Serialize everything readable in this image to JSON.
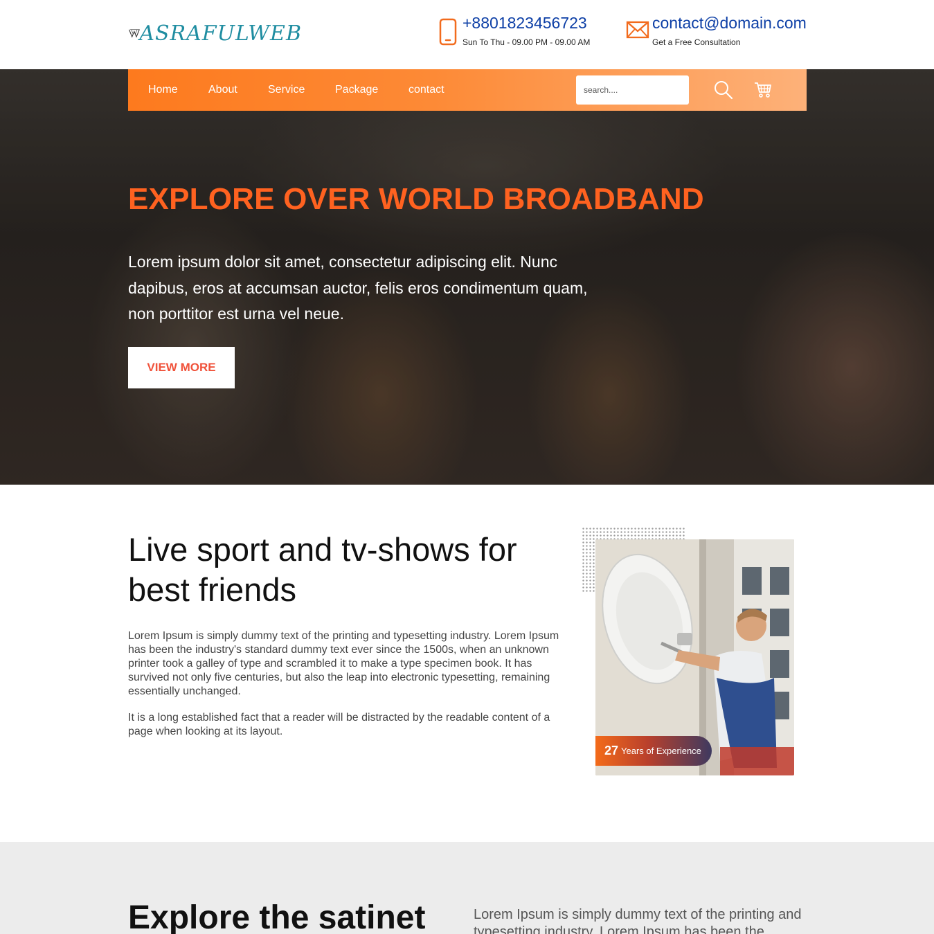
{
  "brand": {
    "name": "ASRAFULWEB",
    "logo_icon": "w-monogram-icon"
  },
  "contact": {
    "phone": "+8801823456723",
    "phone_hours": "Sun To Thu - 09.00 PM - 09.00 AM",
    "email": "contact@domain.com",
    "email_sub": "Get a Free Consultation"
  },
  "nav": {
    "items": [
      "Home",
      "About",
      "Service",
      "Package",
      "contact"
    ],
    "search_placeholder": "search....",
    "icons": [
      "search-icon",
      "cart-icon"
    ]
  },
  "hero": {
    "title": "EXPLORE OVER WORLD BROADBAND",
    "text": "Lorem ipsum dolor sit amet, consectetur adipiscing elit. Nunc dapibus, eros at accumsan auctor, felis eros condimentum quam, non porttitor est urna vel neue.",
    "button": "VIEW MORE"
  },
  "about": {
    "title": "Live sport and tv-shows for best friends",
    "paragraph1": "Lorem Ipsum is simply dummy text of the printing and typesetting industry. Lorem Ipsum has been the industry's standard dummy text ever since the 1500s, when an unknown printer took a galley of type and scrambled it to make a type specimen book. It has survived not only five centuries, but also the leap into electronic typesetting, remaining essentially unchanged.",
    "paragraph2": "It is a long established fact that a reader will be distracted by the readable content of a page when looking at its layout.",
    "experience_years": "27",
    "experience_label": "Years of Experience"
  },
  "explore": {
    "title": "Explore the satinet",
    "text": "Lorem Ipsum is simply dummy text of the printing and typesetting industry. Lorem Ipsum has been the"
  },
  "colors": {
    "accent": "#ff6220",
    "nav_gradient_start": "#fd7a1e",
    "nav_gradient_end": "#fdb179",
    "link_blue": "#0d3fa6",
    "brand_teal": "#1f8da1",
    "button_text": "#f0523a"
  }
}
